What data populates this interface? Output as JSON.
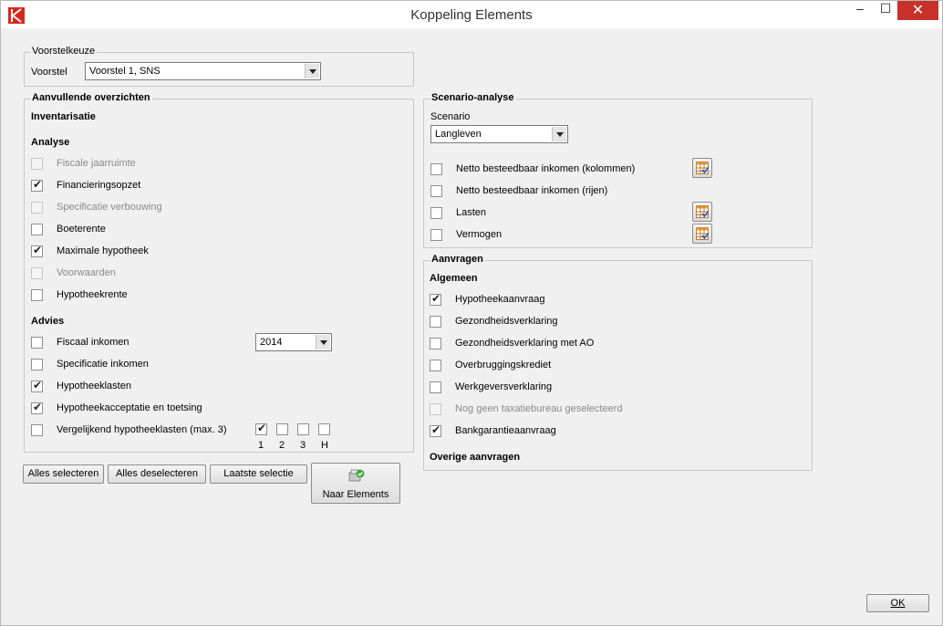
{
  "window": {
    "title": "Koppeling Elements",
    "minimize": "–",
    "maximize": "☐",
    "close": "✕"
  },
  "voorstelkeuze": {
    "legend": "Voorstelkeuze",
    "label": "Voorstel",
    "selected": "Voorstel 1, SNS"
  },
  "aanvullend": {
    "legend": "Aanvullende overzichten",
    "inventarisatie": "Inventarisatie",
    "analyse_heading": "Analyse",
    "analyse": [
      {
        "label": "Fiscale jaarruimte",
        "checked": false,
        "enabled": false
      },
      {
        "label": "Financieringsopzet",
        "checked": true,
        "enabled": true
      },
      {
        "label": "Specificatie verbouwing",
        "checked": false,
        "enabled": false
      },
      {
        "label": "Boeterente",
        "checked": false,
        "enabled": true
      },
      {
        "label": "Maximale hypotheek",
        "checked": true,
        "enabled": true
      },
      {
        "label": "Voorwaarden",
        "checked": false,
        "enabled": false
      },
      {
        "label": "Hypotheekrente",
        "checked": false,
        "enabled": true
      }
    ],
    "advies_heading": "Advies",
    "advies": [
      {
        "label": "Fiscaal inkomen",
        "checked": false,
        "enabled": true
      },
      {
        "label": "Specificatie inkomen",
        "checked": false,
        "enabled": true
      },
      {
        "label": "Hypotheeklasten",
        "checked": true,
        "enabled": true
      },
      {
        "label": "Hypotheekacceptatie en toetsing",
        "checked": true,
        "enabled": true
      },
      {
        "label": "Vergelijkend hypotheeklasten (max. 3)",
        "checked": false,
        "enabled": true
      }
    ],
    "year_selected": "2014",
    "compare_options": [
      {
        "label": "1",
        "checked": true
      },
      {
        "label": "2",
        "checked": false
      },
      {
        "label": "3",
        "checked": false
      },
      {
        "label": "H",
        "checked": false
      }
    ]
  },
  "buttons": {
    "select_all": "Alles selecteren",
    "deselect_all": "Alles deselecteren",
    "last_selection": "Laatste selectie",
    "to_elements": "Naar Elements",
    "ok": "OK"
  },
  "scenario": {
    "legend": "Scenario-analyse",
    "label": "Scenario",
    "selected": "Langleven",
    "items": [
      {
        "label": "Netto besteedbaar inkomen (kolommen)",
        "checked": false,
        "has_grid": true
      },
      {
        "label": "Netto besteedbaar inkomen (rijen)",
        "checked": false,
        "has_grid": false
      },
      {
        "label": "Lasten",
        "checked": false,
        "has_grid": true
      },
      {
        "label": "Vermogen",
        "checked": false,
        "has_grid": true
      }
    ]
  },
  "aanvragen": {
    "legend": "Aanvragen",
    "algemeen_heading": "Algemeen",
    "items": [
      {
        "label": "Hypotheekaanvraag",
        "checked": true,
        "enabled": true
      },
      {
        "label": "Gezondheidsverklaring",
        "checked": false,
        "enabled": true
      },
      {
        "label": "Gezondheidsverklaring met AO",
        "checked": false,
        "enabled": true
      },
      {
        "label": "Overbruggingskrediet",
        "checked": false,
        "enabled": true
      },
      {
        "label": "Werkgeversverklaring",
        "checked": false,
        "enabled": true
      },
      {
        "label": "Nog geen taxatiebureau geselecteerd",
        "checked": false,
        "enabled": false
      },
      {
        "label": "Bankgarantieaanvraag",
        "checked": true,
        "enabled": true
      }
    ],
    "overige_heading": "Overige aanvragen"
  },
  "icons": {
    "app": "app-logo-icon",
    "grid": "grid-table-icon",
    "elements": "elements-export-icon"
  },
  "colors": {
    "close_button": "#c7312a",
    "app_icon": "#d9261c"
  }
}
